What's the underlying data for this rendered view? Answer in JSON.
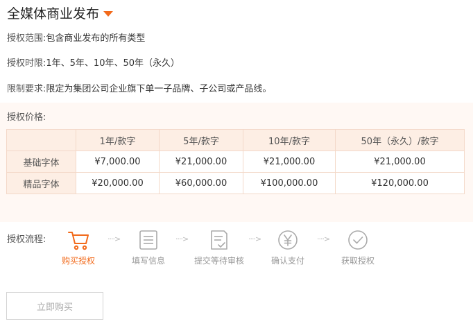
{
  "header": {
    "title": "全媒体商业发布"
  },
  "info": {
    "scope_label": "授权范围:",
    "scope_value": "包含商业发布的所有类型",
    "period_label": "授权时限:",
    "period_value": "1年、5年、10年、50年（永久）",
    "restrict_label": "限制要求:",
    "restrict_value": "限定为集团公司企业旗下单一子品牌、子公司或产品线。"
  },
  "pricing": {
    "title": "授权价格:",
    "columns": [
      "",
      "1年/款字",
      "5年/款字",
      "10年/款字",
      "50年（永久）/款字"
    ],
    "rows": [
      {
        "name": "基础字体",
        "prices": [
          "¥7,000.00",
          "¥21,000.00",
          "¥21,000.00",
          "¥21,000.00"
        ]
      },
      {
        "name": "精品字体",
        "prices": [
          "¥20,000.00",
          "¥60,000.00",
          "¥100,000.00",
          "¥120,000.00"
        ]
      }
    ]
  },
  "flow": {
    "label": "授权流程:",
    "arrow": "····>",
    "steps": [
      {
        "label": "购买授权",
        "icon": "cart-icon",
        "active": true
      },
      {
        "label": "填写信息",
        "icon": "form-icon",
        "active": false
      },
      {
        "label": "提交等待审核",
        "icon": "document-check-icon",
        "active": false
      },
      {
        "label": "确认支付",
        "icon": "yen-icon",
        "active": false
      },
      {
        "label": "获取授权",
        "icon": "checkmark-circle-icon",
        "active": false
      }
    ]
  },
  "actions": {
    "buy_label": "立即购买"
  },
  "colors": {
    "accent": "#f26a1b",
    "table_header_bg": "#fdeee4",
    "panel_bg": "#fff8f4"
  }
}
